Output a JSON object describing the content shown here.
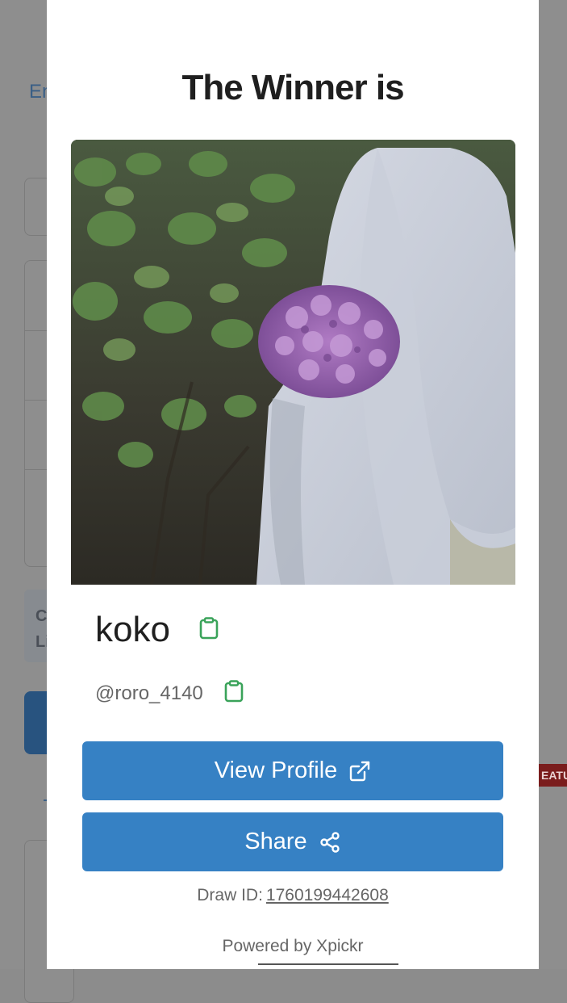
{
  "background": {
    "partial_text": "En",
    "card_partial_line1": "C",
    "card_partial_line2": "Li",
    "badge_partial": "EATU"
  },
  "modal": {
    "title": "The Winner is",
    "winner": {
      "name": "koko",
      "handle": "@roro_4140"
    },
    "buttons": {
      "view_profile": "View Profile",
      "share": "Share"
    },
    "draw_id_label": "Draw ID:",
    "draw_id_value": "1760199442608",
    "powered_by": "Powered by Xpickr"
  },
  "colors": {
    "primary_button": "#3681c4",
    "copy_icon": "#3aa35a",
    "overlay": "#8e8e8e"
  },
  "icons": {
    "copy": "clipboard-icon",
    "external": "external-link-icon",
    "share": "share-nodes-icon"
  }
}
